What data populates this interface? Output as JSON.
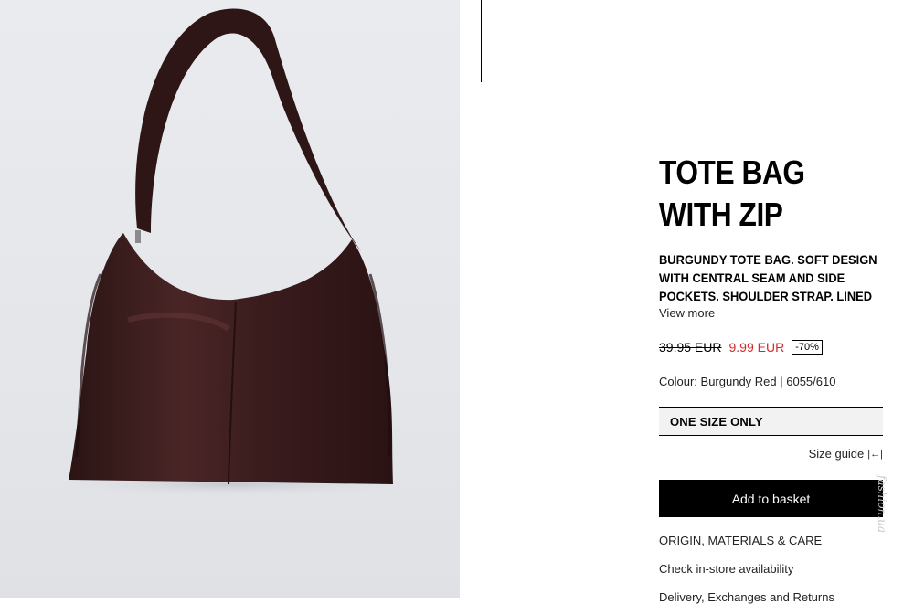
{
  "product": {
    "title": "TOTE BAG WITH ZIP",
    "description": "BURGUNDY TOTE BAG. SOFT DESIGN WITH CENTRAL SEAM AND SIDE POCKETS. SHOULDER STRAP. LINED",
    "view_more": "View more",
    "old_price": "39.95 EUR",
    "new_price": "9.99 EUR",
    "discount": "-70%",
    "colour": "Colour: Burgundy Red | 6055/610",
    "size": "ONE SIZE ONLY",
    "size_guide": "Size guide",
    "add_to_basket": "Add to basket",
    "links": [
      "ORIGIN, MATERIALS & CARE",
      "Check in-store availability",
      "Delivery, Exchanges and Returns"
    ]
  },
  "icons": {
    "size_guide": "ruler-icon"
  },
  "colors": {
    "price_sale": "#d22b2b",
    "button_bg": "#000000",
    "image_bg": "#e6e8eb",
    "bag": "#3d1f1f"
  },
  "watermark": "fashion.ua"
}
